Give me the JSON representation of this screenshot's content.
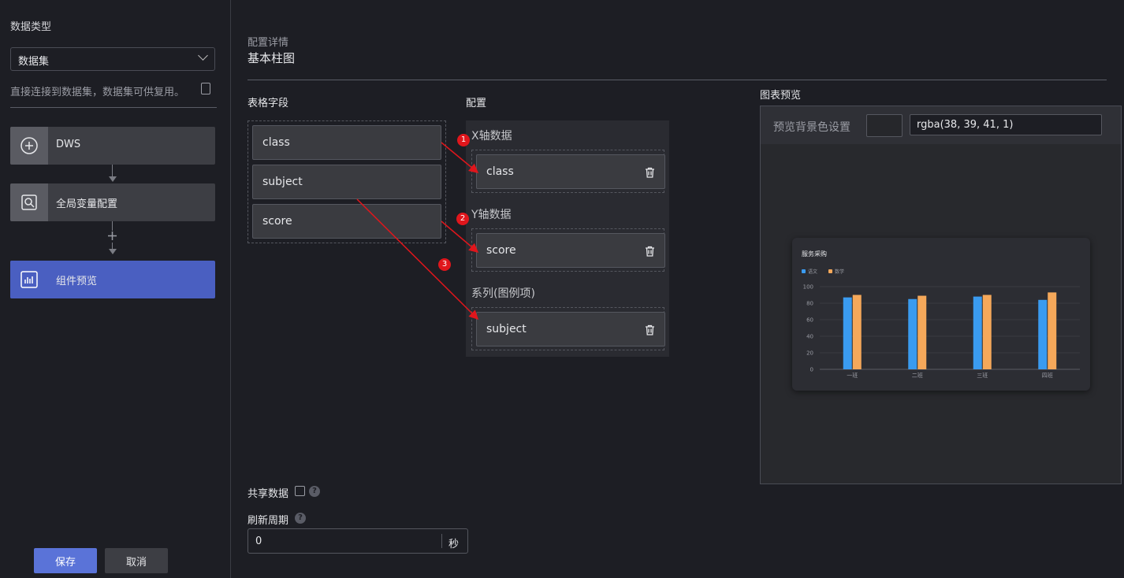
{
  "sidebar": {
    "data_type_label": "数据类型",
    "dataset_select": "数据集",
    "hint": "直接连接到数据集，数据集可供复用。",
    "steps": [
      {
        "label": "DWS",
        "icon": "plus-circle-icon"
      },
      {
        "label": "全局变量配置",
        "icon": "variable-search-icon"
      },
      {
        "label": "组件预览",
        "icon": "chart-preview-icon"
      }
    ],
    "save_label": "保存",
    "cancel_label": "取消"
  },
  "config": {
    "detail_label": "配置详情",
    "chart_name": "基本柱图",
    "table_fields_label": "表格字段",
    "config_label": "配置",
    "fields": [
      "class",
      "subject",
      "score"
    ],
    "x_axis_label": "X轴数据",
    "x_axis_value": "class",
    "y_axis_label": "Y轴数据",
    "y_axis_value": "score",
    "series_label": "系列(图例项)",
    "series_value": "subject",
    "badges": [
      "1",
      "2",
      "3"
    ],
    "share_data_label": "共享数据",
    "refresh_label": "刷新周期",
    "refresh_value": "0",
    "refresh_unit": "秒"
  },
  "preview": {
    "title": "图表预览",
    "bg_setting_label": "预览背景色设置",
    "bg_color_value": "rgba(38, 39, 41, 1)"
  },
  "chart_data": {
    "type": "bar",
    "title": "服务采购",
    "categories": [
      "一班",
      "二班",
      "三班",
      "四班"
    ],
    "series": [
      {
        "name": "语文",
        "values": [
          87,
          85,
          88,
          84
        ],
        "color": "#3a9bf0"
      },
      {
        "name": "数学",
        "values": [
          90,
          89,
          90,
          93
        ],
        "color": "#f5a85a"
      }
    ],
    "ylim": [
      0,
      100
    ],
    "yticks": [
      "0",
      "20",
      "40",
      "60",
      "80",
      "100"
    ],
    "legend": "top-left",
    "grid": true
  },
  "colors": {
    "accent": "#4a5fc1",
    "badge": "#e0161c",
    "arrow": "#e0161c"
  }
}
